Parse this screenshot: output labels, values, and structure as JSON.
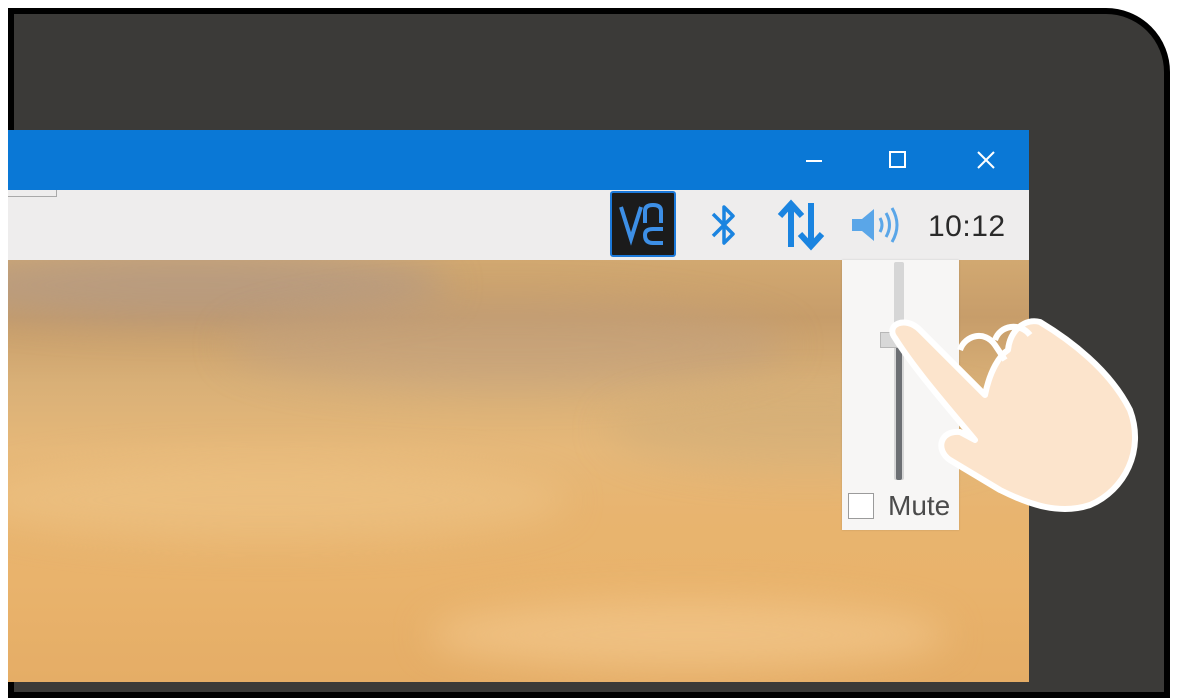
{
  "titlebar": {
    "minimize_icon": "minimize-icon",
    "maximize_icon": "maximize-icon",
    "close_icon": "close-icon"
  },
  "tray": {
    "icons": [
      "vnc-icon",
      "bluetooth-icon",
      "network-icon",
      "volume-icon"
    ],
    "clock": "10:12",
    "accent_color": "#1a84e0"
  },
  "volume_popup": {
    "level_fraction": 0.64,
    "mute_label": "Mute",
    "mute_checked": false
  }
}
